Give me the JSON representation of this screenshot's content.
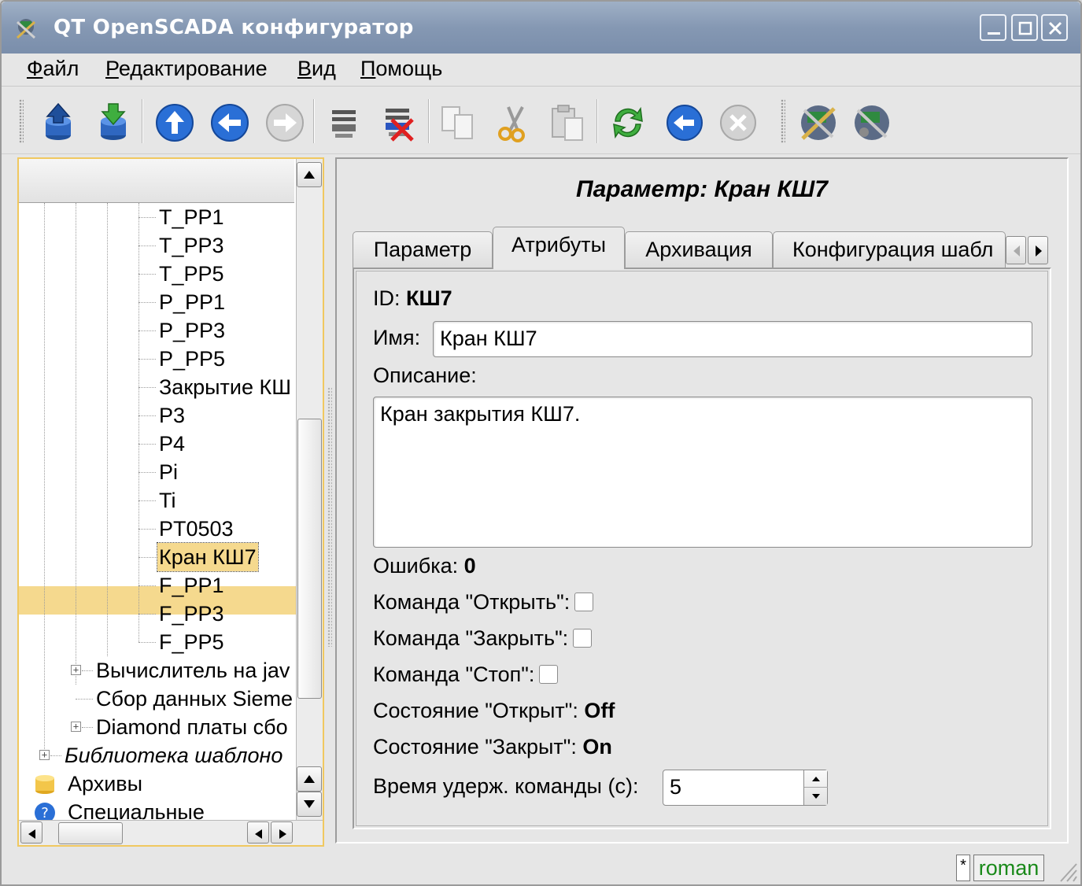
{
  "window": {
    "title": "QT OpenSCADA конфигуратор"
  },
  "menu": {
    "items": [
      {
        "first": "Ф",
        "rest": "айл"
      },
      {
        "first": "Р",
        "rest": "едактирование"
      },
      {
        "first": "В",
        "rest": "ид"
      },
      {
        "first": "П",
        "rest": "омощь"
      }
    ]
  },
  "toolbar": {
    "icons": [
      "db-load-icon",
      "db-save-icon",
      "up-icon",
      "back-icon",
      "forward-icon",
      "item-add-icon",
      "item-delete-icon",
      "copy-icon",
      "cut-icon",
      "paste-icon",
      "refresh-icon",
      "start-icon",
      "stop-icon",
      "station-icon",
      "station-remote-icon"
    ]
  },
  "tree": {
    "items": [
      {
        "label": "T_PP1"
      },
      {
        "label": "T_PP3"
      },
      {
        "label": "T_PP5"
      },
      {
        "label": "P_PP1"
      },
      {
        "label": "P_PP3"
      },
      {
        "label": "P_PP5"
      },
      {
        "label": "Закрытие КШ"
      },
      {
        "label": "P3"
      },
      {
        "label": "P4"
      },
      {
        "label": "Pi"
      },
      {
        "label": "Ti"
      },
      {
        "label": "PT0503"
      },
      {
        "label": "Кран КШ7",
        "selected": true
      },
      {
        "label": "F_PP1"
      },
      {
        "label": "F_PP3"
      },
      {
        "label": "F_PP5"
      },
      {
        "label": "Вычислитель на jav"
      },
      {
        "label": "Сбор данных Sieme"
      },
      {
        "label": "Diamond платы сбо"
      },
      {
        "label": "Библиотека шаблоно"
      },
      {
        "label": "Архивы"
      },
      {
        "label": "Специальные"
      }
    ]
  },
  "page": {
    "title": "Параметр: Кран КШ7",
    "tabs": [
      {
        "label": "Параметр",
        "active": false
      },
      {
        "label": "Атрибуты",
        "active": true
      },
      {
        "label": "Архивация",
        "active": false
      },
      {
        "label": "Конфигурация шабл",
        "active": false
      }
    ]
  },
  "attributes": {
    "id_label": "ID:",
    "id_value": "КШ7",
    "name_label": "Имя:",
    "name_value": "Кран КШ7",
    "descr_label": "Описание:",
    "descr_value": "Кран закрытия КШ7.",
    "err_label": "Ошибка:",
    "err_value": "0",
    "cmd_open_label": "Команда \"Открыть\":",
    "cmd_open_checked": false,
    "cmd_close_label": "Команда \"Закрыть\":",
    "cmd_close_checked": false,
    "cmd_stop_label": "Команда \"Стоп\":",
    "cmd_stop_checked": false,
    "st_open_label": "Состояние \"Открыт\":",
    "st_open_value": "Off",
    "st_close_label": "Состояние \"Закрыт\":",
    "st_close_value": "On",
    "hold_label": "Время удерж. команды (с):",
    "hold_value": "5"
  },
  "status": {
    "modified": "*",
    "user": "roman"
  }
}
